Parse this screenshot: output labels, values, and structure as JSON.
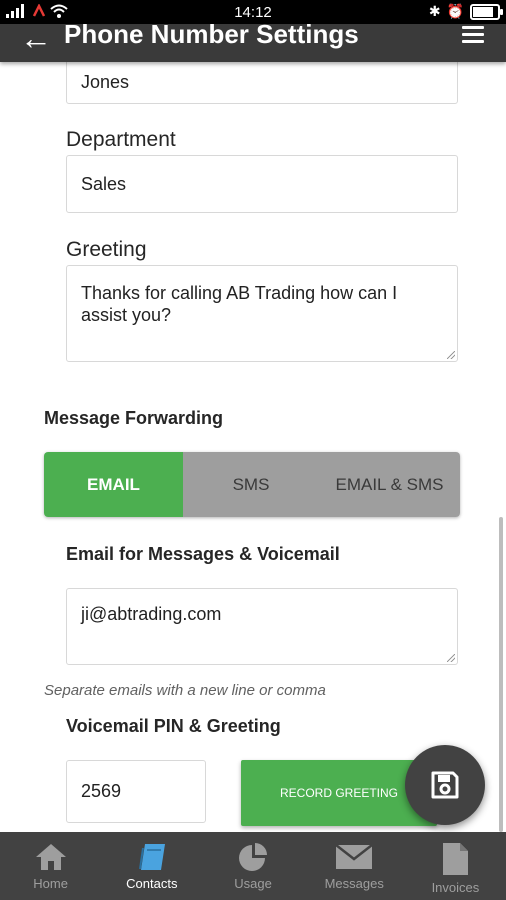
{
  "status_bar": {
    "time": "14:12"
  },
  "app_bar": {
    "title": "Phone Number Settings"
  },
  "form": {
    "last_name_value": "Jones",
    "department_label": "Department",
    "department_value": "Sales",
    "greeting_label": "Greeting",
    "greeting_value": "Thanks for calling AB Trading how can I assist you?",
    "message_forwarding_title": "Message Forwarding",
    "forwarding_options": [
      "EMAIL",
      "SMS",
      "EMAIL & SMS"
    ],
    "forwarding_selected": "EMAIL",
    "email_label": "Email for Messages & Voicemail",
    "email_value": "ji@abtrading.com",
    "email_help": "Separate emails with a new line or comma",
    "voicemail_label": "Voicemail PIN & Greeting",
    "pin_value": "2569",
    "record_button": "RECORD GREETING"
  },
  "bottom_nav": {
    "items": [
      {
        "label": "Home",
        "icon": "home-icon"
      },
      {
        "label": "Contacts",
        "icon": "book-icon"
      },
      {
        "label": "Usage",
        "icon": "pie-chart-icon"
      },
      {
        "label": "Messages",
        "icon": "envelope-icon"
      },
      {
        "label": "Invoices",
        "icon": "document-icon"
      }
    ],
    "active": "Contacts"
  },
  "colors": {
    "accent": "#4caf50",
    "app_bar": "#3a3a3a",
    "nav_bar": "#424242",
    "active_icon": "#4aa3df"
  }
}
